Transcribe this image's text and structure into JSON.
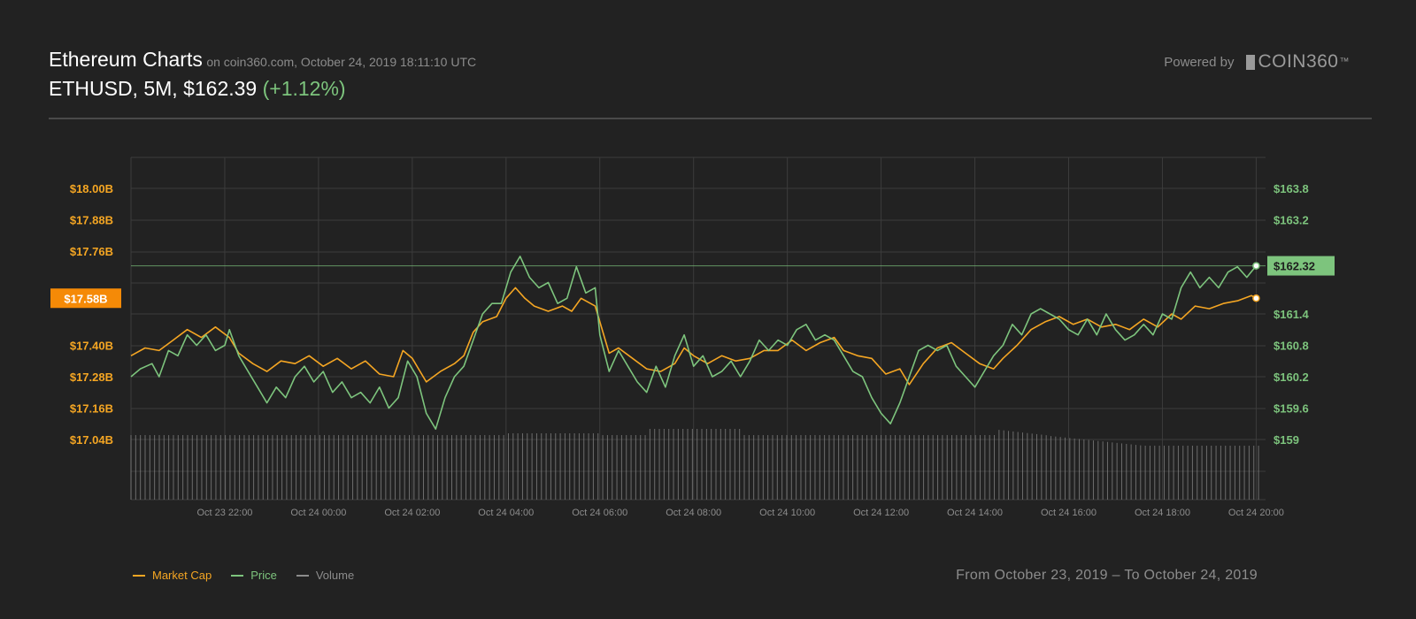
{
  "header": {
    "title": "Ethereum Charts",
    "subtitle": "on coin360.com, October 24, 2019 18:11:10 UTC",
    "pair_info": "ETHUSD, 5M, $162.39",
    "change": "(+1.12%)"
  },
  "branding": {
    "powered_label": "Powered by",
    "logo_text": "COIN360",
    "logo_tm": "™"
  },
  "legend": [
    {
      "label": "Market Cap",
      "color": "#f5a623"
    },
    {
      "label": "Price",
      "color": "#7dc47d"
    },
    {
      "label": "Volume",
      "color": "#8c8c8c"
    }
  ],
  "date_range": {
    "from": "From October 23, 2019",
    "separator": "–",
    "to": "To October 24, 2019"
  },
  "colors": {
    "background": "#222222",
    "grid": "#3c3c3c",
    "market_cap": "#f5a623",
    "price": "#7dc47d",
    "volume": "#8c8c8c"
  },
  "chart_data": {
    "type": "line",
    "x_ticks": [
      "Oct 23 22:00",
      "Oct 24 00:00",
      "Oct 24 02:00",
      "Oct 24 04:00",
      "Oct 24 06:00",
      "Oct 24 08:00",
      "Oct 24 10:00",
      "Oct 24 12:00",
      "Oct 24 14:00",
      "Oct 24 16:00",
      "Oct 24 18:00",
      "Oct 24 20:00"
    ],
    "x_tick_hours": [
      2,
      4,
      6,
      8,
      10,
      12,
      14,
      16,
      18,
      20,
      22,
      24
    ],
    "x_range_hours": [
      0,
      24.2
    ],
    "left_axis": {
      "ticks": [
        "$18.00B",
        "$17.88B",
        "$17.76B",
        "$17.40B",
        "$17.28B",
        "$17.16B",
        "$17.04B"
      ],
      "tick_values": [
        18.0,
        17.88,
        17.76,
        17.4,
        17.28,
        17.16,
        17.04
      ],
      "current_label": "$17.58B",
      "current_value": 17.58
    },
    "right_axis": {
      "ticks": [
        "$163.8",
        "$163.2",
        "$161.4",
        "$160.8",
        "$160.2",
        "$159.6",
        "$159"
      ],
      "tick_values": [
        163.8,
        163.2,
        161.4,
        160.8,
        160.2,
        159.6,
        159.0
      ],
      "current_label": "$162.32",
      "current_value": 162.32
    },
    "series": [
      {
        "name": "Market Cap",
        "unit": "B",
        "points": [
          [
            0,
            17.36
          ],
          [
            0.3,
            17.39
          ],
          [
            0.6,
            17.38
          ],
          [
            0.9,
            17.42
          ],
          [
            1.2,
            17.46
          ],
          [
            1.5,
            17.43
          ],
          [
            1.8,
            17.47
          ],
          [
            2.1,
            17.43
          ],
          [
            2.3,
            17.37
          ],
          [
            2.6,
            17.33
          ],
          [
            2.9,
            17.3
          ],
          [
            3.2,
            17.34
          ],
          [
            3.5,
            17.33
          ],
          [
            3.8,
            17.36
          ],
          [
            4.1,
            17.32
          ],
          [
            4.4,
            17.35
          ],
          [
            4.7,
            17.31
          ],
          [
            5.0,
            17.34
          ],
          [
            5.3,
            17.29
          ],
          [
            5.6,
            17.28
          ],
          [
            5.8,
            17.38
          ],
          [
            6.0,
            17.35
          ],
          [
            6.3,
            17.26
          ],
          [
            6.6,
            17.3
          ],
          [
            6.9,
            17.33
          ],
          [
            7.1,
            17.36
          ],
          [
            7.3,
            17.45
          ],
          [
            7.5,
            17.49
          ],
          [
            7.8,
            17.51
          ],
          [
            8.0,
            17.58
          ],
          [
            8.2,
            17.62
          ],
          [
            8.4,
            17.58
          ],
          [
            8.6,
            17.55
          ],
          [
            8.9,
            17.53
          ],
          [
            9.2,
            17.55
          ],
          [
            9.4,
            17.53
          ],
          [
            9.6,
            17.58
          ],
          [
            9.9,
            17.55
          ],
          [
            10.0,
            17.49
          ],
          [
            10.2,
            17.37
          ],
          [
            10.4,
            17.39
          ],
          [
            10.7,
            17.35
          ],
          [
            11.0,
            17.31
          ],
          [
            11.3,
            17.3
          ],
          [
            11.6,
            17.33
          ],
          [
            11.8,
            17.39
          ],
          [
            12.0,
            17.36
          ],
          [
            12.3,
            17.33
          ],
          [
            12.6,
            17.36
          ],
          [
            12.9,
            17.34
          ],
          [
            13.2,
            17.35
          ],
          [
            13.5,
            17.38
          ],
          [
            13.8,
            17.38
          ],
          [
            14.1,
            17.42
          ],
          [
            14.4,
            17.38
          ],
          [
            14.7,
            17.41
          ],
          [
            15.0,
            17.43
          ],
          [
            15.2,
            17.38
          ],
          [
            15.5,
            17.36
          ],
          [
            15.8,
            17.35
          ],
          [
            16.1,
            17.29
          ],
          [
            16.4,
            17.31
          ],
          [
            16.6,
            17.25
          ],
          [
            16.9,
            17.33
          ],
          [
            17.2,
            17.39
          ],
          [
            17.5,
            17.41
          ],
          [
            17.8,
            17.37
          ],
          [
            18.1,
            17.33
          ],
          [
            18.4,
            17.31
          ],
          [
            18.6,
            17.35
          ],
          [
            18.9,
            17.4
          ],
          [
            19.2,
            17.46
          ],
          [
            19.5,
            17.49
          ],
          [
            19.8,
            17.51
          ],
          [
            20.1,
            17.48
          ],
          [
            20.4,
            17.5
          ],
          [
            20.7,
            17.47
          ],
          [
            21.0,
            17.48
          ],
          [
            21.3,
            17.46
          ],
          [
            21.6,
            17.5
          ],
          [
            21.9,
            17.47
          ],
          [
            22.2,
            17.52
          ],
          [
            22.4,
            17.5
          ],
          [
            22.7,
            17.55
          ],
          [
            23.0,
            17.54
          ],
          [
            23.3,
            17.56
          ],
          [
            23.6,
            17.57
          ],
          [
            23.9,
            17.59
          ],
          [
            24.0,
            17.58
          ]
        ]
      },
      {
        "name": "Price",
        "unit": "$",
        "points": [
          [
            0,
            160.2
          ],
          [
            0.2,
            160.35
          ],
          [
            0.45,
            160.45
          ],
          [
            0.6,
            160.2
          ],
          [
            0.8,
            160.7
          ],
          [
            1.0,
            160.6
          ],
          [
            1.2,
            161.0
          ],
          [
            1.4,
            160.8
          ],
          [
            1.6,
            161.0
          ],
          [
            1.8,
            160.7
          ],
          [
            2.0,
            160.8
          ],
          [
            2.1,
            161.1
          ],
          [
            2.3,
            160.6
          ],
          [
            2.5,
            160.3
          ],
          [
            2.7,
            160.0
          ],
          [
            2.9,
            159.7
          ],
          [
            3.1,
            160.0
          ],
          [
            3.3,
            159.8
          ],
          [
            3.5,
            160.2
          ],
          [
            3.7,
            160.4
          ],
          [
            3.9,
            160.1
          ],
          [
            4.1,
            160.3
          ],
          [
            4.3,
            159.9
          ],
          [
            4.5,
            160.1
          ],
          [
            4.7,
            159.8
          ],
          [
            4.9,
            159.9
          ],
          [
            5.1,
            159.7
          ],
          [
            5.3,
            160.0
          ],
          [
            5.5,
            159.6
          ],
          [
            5.7,
            159.8
          ],
          [
            5.9,
            160.5
          ],
          [
            6.1,
            160.2
          ],
          [
            6.3,
            159.5
          ],
          [
            6.5,
            159.2
          ],
          [
            6.7,
            159.8
          ],
          [
            6.9,
            160.2
          ],
          [
            7.1,
            160.4
          ],
          [
            7.3,
            160.9
          ],
          [
            7.5,
            161.4
          ],
          [
            7.7,
            161.6
          ],
          [
            7.9,
            161.6
          ],
          [
            8.1,
            162.2
          ],
          [
            8.3,
            162.5
          ],
          [
            8.5,
            162.1
          ],
          [
            8.7,
            161.9
          ],
          [
            8.9,
            162.0
          ],
          [
            9.1,
            161.6
          ],
          [
            9.3,
            161.7
          ],
          [
            9.5,
            162.3
          ],
          [
            9.7,
            161.8
          ],
          [
            9.9,
            161.9
          ],
          [
            10.0,
            161.0
          ],
          [
            10.2,
            160.3
          ],
          [
            10.4,
            160.7
          ],
          [
            10.6,
            160.4
          ],
          [
            10.8,
            160.1
          ],
          [
            11.0,
            159.9
          ],
          [
            11.2,
            160.4
          ],
          [
            11.4,
            160.0
          ],
          [
            11.6,
            160.6
          ],
          [
            11.8,
            161.0
          ],
          [
            12.0,
            160.4
          ],
          [
            12.2,
            160.6
          ],
          [
            12.4,
            160.2
          ],
          [
            12.6,
            160.3
          ],
          [
            12.8,
            160.5
          ],
          [
            13.0,
            160.2
          ],
          [
            13.2,
            160.5
          ],
          [
            13.4,
            160.9
          ],
          [
            13.6,
            160.7
          ],
          [
            13.8,
            160.9
          ],
          [
            14.0,
            160.8
          ],
          [
            14.2,
            161.1
          ],
          [
            14.4,
            161.2
          ],
          [
            14.6,
            160.9
          ],
          [
            14.8,
            161.0
          ],
          [
            15.0,
            160.9
          ],
          [
            15.2,
            160.6
          ],
          [
            15.4,
            160.3
          ],
          [
            15.6,
            160.2
          ],
          [
            15.8,
            159.8
          ],
          [
            16.0,
            159.5
          ],
          [
            16.2,
            159.3
          ],
          [
            16.4,
            159.7
          ],
          [
            16.6,
            160.2
          ],
          [
            16.8,
            160.7
          ],
          [
            17.0,
            160.8
          ],
          [
            17.2,
            160.7
          ],
          [
            17.4,
            160.8
          ],
          [
            17.6,
            160.4
          ],
          [
            17.8,
            160.2
          ],
          [
            18.0,
            160.0
          ],
          [
            18.2,
            160.3
          ],
          [
            18.4,
            160.6
          ],
          [
            18.6,
            160.8
          ],
          [
            18.8,
            161.2
          ],
          [
            19.0,
            161.0
          ],
          [
            19.2,
            161.4
          ],
          [
            19.4,
            161.5
          ],
          [
            19.6,
            161.4
          ],
          [
            19.8,
            161.3
          ],
          [
            20.0,
            161.1
          ],
          [
            20.2,
            161.0
          ],
          [
            20.4,
            161.3
          ],
          [
            20.6,
            161.0
          ],
          [
            20.8,
            161.4
          ],
          [
            21.0,
            161.1
          ],
          [
            21.2,
            160.9
          ],
          [
            21.4,
            161.0
          ],
          [
            21.6,
            161.2
          ],
          [
            21.8,
            161.0
          ],
          [
            22.0,
            161.4
          ],
          [
            22.2,
            161.3
          ],
          [
            22.4,
            161.9
          ],
          [
            22.6,
            162.2
          ],
          [
            22.8,
            161.9
          ],
          [
            23.0,
            162.1
          ],
          [
            23.2,
            161.9
          ],
          [
            23.4,
            162.2
          ],
          [
            23.6,
            162.3
          ],
          [
            23.8,
            162.1
          ],
          [
            24.0,
            162.32
          ]
        ]
      }
    ]
  }
}
